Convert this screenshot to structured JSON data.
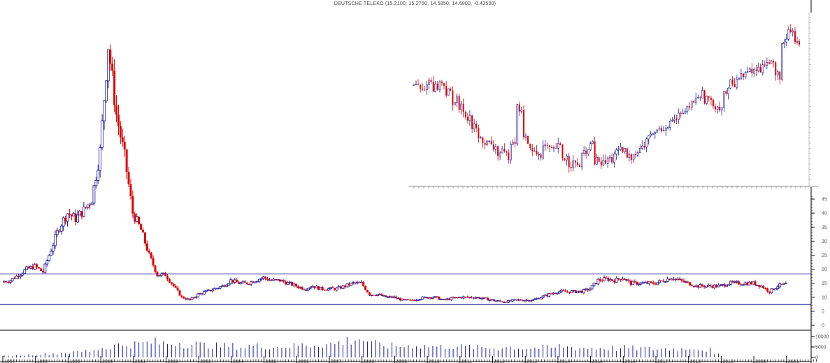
{
  "title": "DEUTSCHE TELEKO (15.2100, 15.2750, 14.5850, 14.6800, -0.43500)",
  "chart_data": {
    "type": "candlestick",
    "title": "DEUTSCHE TELEKO (15.2100, 15.2750, 14.5850, 14.6800, -0.43500)",
    "last": {
      "open": 15.21,
      "high": 15.275,
      "low": 14.585,
      "close": 14.68,
      "change": -0.435
    },
    "colors": {
      "up": "#1c1c9c",
      "down": "#e00000",
      "hline": "#1c1c9c",
      "axis": "#000000"
    },
    "x_tick_labels": [
      "1997",
      "1998",
      "1999",
      "2000",
      "2001",
      "2002",
      "2003",
      "2004",
      "2005",
      "2006",
      "2007",
      "2008",
      "2009",
      "2010",
      "2011",
      "2012",
      "2013",
      "2014",
      "2015",
      "2016",
      "2017",
      "2018",
      "2019",
      "2020",
      "2021"
    ],
    "y_tick_labels": [
      "45",
      "40",
      "35",
      "30",
      "25",
      "20",
      "15",
      "10",
      "5",
      "0"
    ],
    "ylim": [
      0,
      108
    ],
    "horizontal_lines": [
      18.3,
      7.4
    ],
    "quarterly_closes": {
      "start_year": 1997,
      "values": [
        16,
        18,
        20,
        21,
        19,
        27,
        35,
        40,
        38,
        41,
        45,
        62,
        100,
        75,
        60,
        40,
        34,
        25,
        18,
        18,
        14,
        10,
        9,
        11,
        12,
        13,
        14,
        16,
        15,
        15,
        16,
        17,
        16,
        16,
        15,
        14,
        13,
        14,
        13,
        13,
        13,
        14,
        15,
        15,
        11,
        11,
        10,
        10,
        9,
        8.8,
        9.5,
        10,
        10,
        9,
        9.5,
        10,
        10,
        10,
        9.5,
        9,
        8.5,
        8.5,
        9,
        9,
        9,
        10,
        11,
        12,
        12,
        12,
        12,
        13,
        16,
        16.5,
        16,
        17,
        15,
        15,
        15,
        15,
        16,
        17,
        16,
        15,
        14,
        14,
        14,
        14,
        15,
        15,
        15,
        15,
        14,
        12,
        14,
        14.7
      ]
    },
    "volume": {
      "y_tick_labels": [
        "10000",
        "5000",
        "0"
      ],
      "quarterly": [
        800,
        1000,
        1200,
        1500,
        1500,
        1800,
        2000,
        2500,
        2500,
        3000,
        3500,
        4500,
        5000,
        6000,
        6500,
        7000,
        7000,
        7500,
        8000,
        7500,
        7500,
        8000,
        7000,
        7000,
        6500,
        6500,
        6000,
        6000,
        6000,
        5500,
        6000,
        6000,
        6000,
        5500,
        6000,
        6000,
        6500,
        6500,
        7000,
        7000,
        7000,
        8000,
        9000,
        10000,
        9000,
        7000,
        6500,
        6000,
        6000,
        6000,
        6500,
        6000,
        6000,
        5500,
        6000,
        6000,
        5500,
        5500,
        5000,
        5000,
        5000,
        5500,
        5500,
        5000,
        5000,
        5000,
        5000,
        5000,
        6000,
        5500,
        5000,
        5000,
        5000,
        5000,
        5000,
        4500,
        5000,
        4800,
        4800,
        4500,
        4500,
        4500,
        4500,
        4500,
        5500,
        4500,
        4000,
        1500
      ]
    },
    "inset": {
      "type": "candlestick",
      "closes": [
        16.4,
        16.1,
        16.6,
        16.3,
        16.5,
        16.0,
        15.6,
        15.2,
        14.8,
        14.2,
        13.6,
        13.4,
        13.2,
        12.9,
        12.8,
        13.6,
        15.2,
        13.6,
        13.0,
        12.9,
        13.2,
        13.0,
        13.2,
        12.7,
        12.4,
        12.3,
        12.8,
        13.3,
        12.5,
        12.4,
        12.6,
        12.9,
        13.0,
        12.7,
        13.0,
        13.2,
        13.7,
        14.0,
        14.2,
        14.4,
        14.6,
        14.8,
        15.1,
        15.6,
        15.9,
        15.7,
        15.4,
        15.3,
        16.0,
        16.5,
        16.8,
        17.0,
        17.1,
        17.2,
        17.6,
        17.5,
        16.9,
        18.5,
        19.1,
        18.6
      ]
    },
    "grid": false
  }
}
